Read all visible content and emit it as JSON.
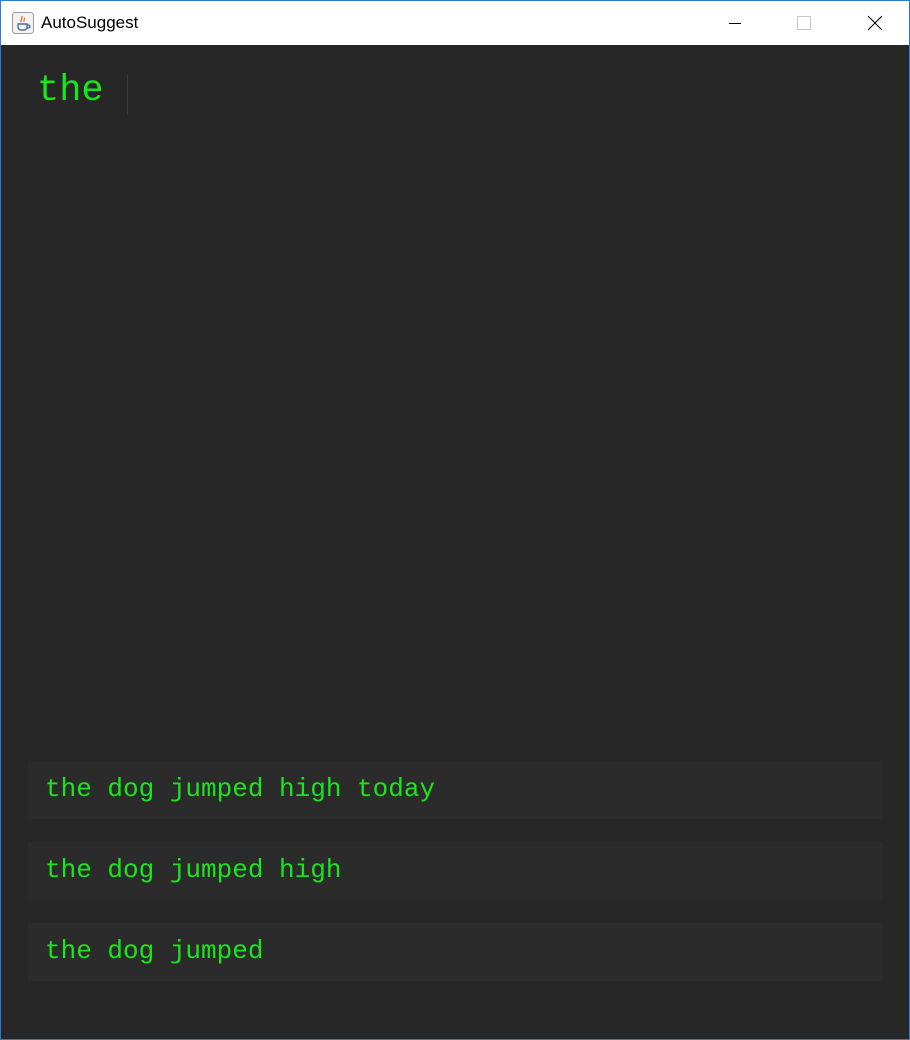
{
  "window": {
    "title": "AutoSuggest",
    "icon": "java-cup-icon",
    "controls": [
      "minimize-icon",
      "maximize-icon",
      "close-icon"
    ]
  },
  "editor": {
    "input_value": "the"
  },
  "suggestions": [
    {
      "text": "the dog jumped high today"
    },
    {
      "text": "the dog jumped high"
    },
    {
      "text": "the dog jumped"
    }
  ],
  "colors": {
    "background": "#282728",
    "suggestion_background": "#2c2b2c",
    "text": "#19e61d",
    "window_border": "#2b7bd6"
  }
}
